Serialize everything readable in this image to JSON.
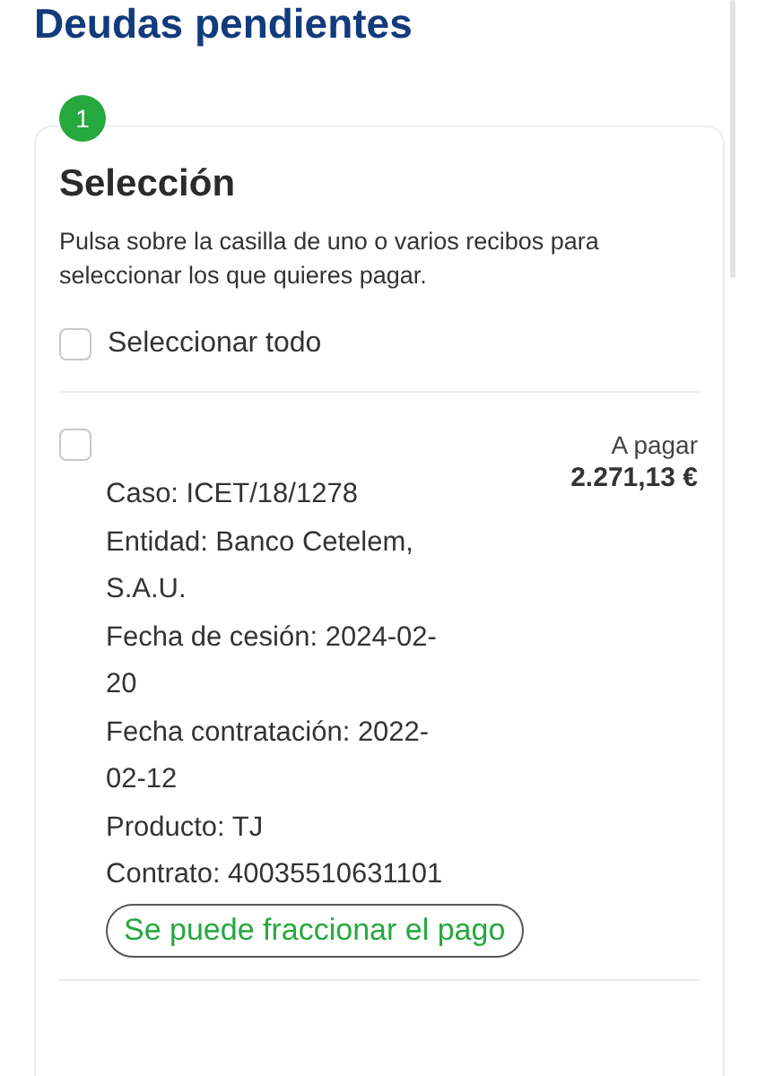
{
  "title": "Deudas pendientes",
  "step": {
    "number": "1",
    "title": "Selección",
    "description": "Pulsa sobre la casilla de uno o varios recibos para seleccionar los que quieres pagar."
  },
  "select_all": {
    "label": "Seleccionar todo",
    "checked": false
  },
  "debts": [
    {
      "checked": false,
      "amount_label": "A pagar",
      "amount": "2.271,13 €",
      "details": [
        "Caso: ICET/18/1278",
        "Entidad: Banco Cetelem, S.A.U.",
        "Fecha de cesión: 2024-02-20",
        "Fecha contratación: 2022-02-12",
        "Producto: TJ",
        "Contrato: 40035510631101"
      ],
      "tag": "Se puede fraccionar el pago"
    }
  ]
}
